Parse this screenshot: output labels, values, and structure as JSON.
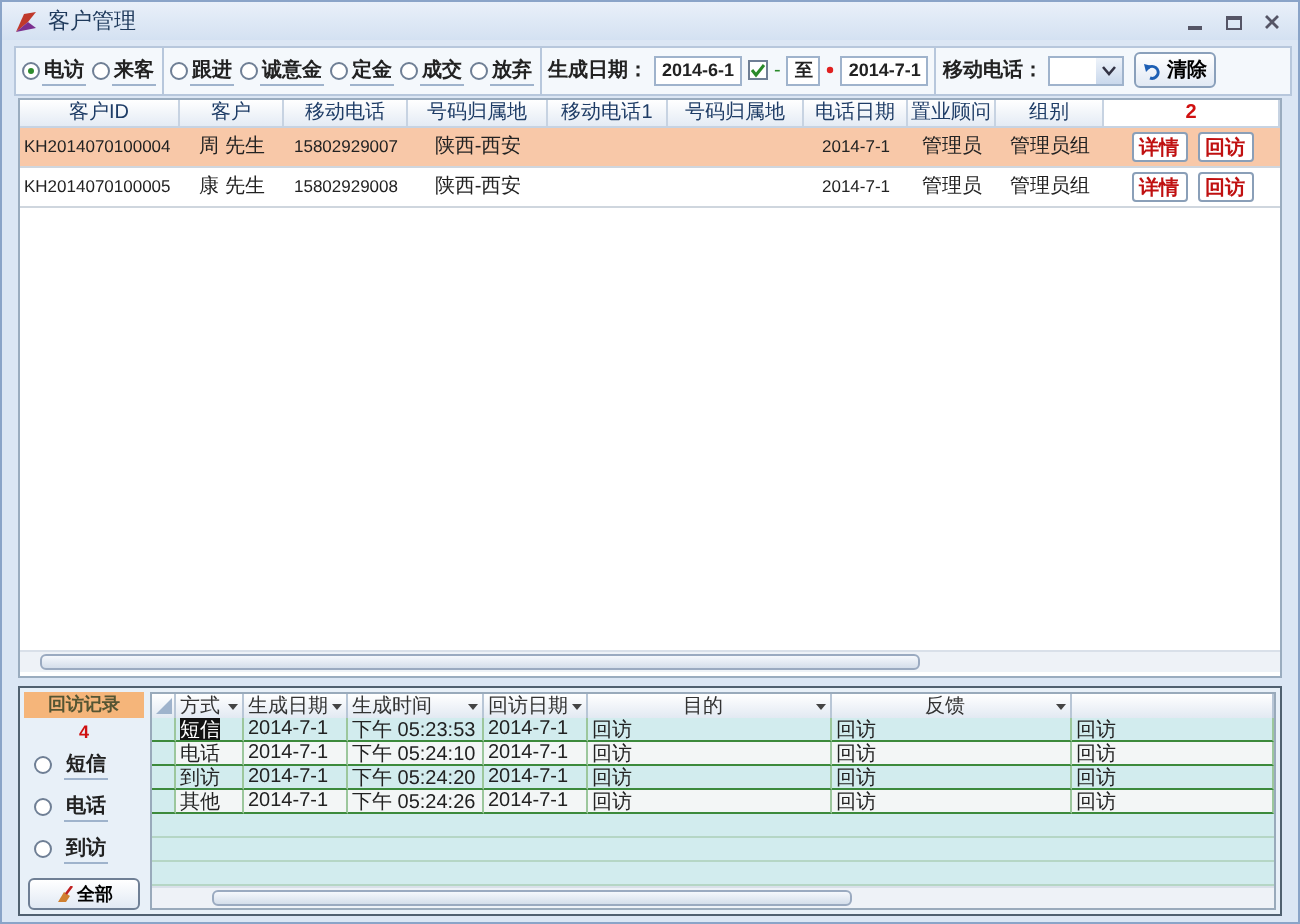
{
  "window": {
    "title": "客户管理"
  },
  "filters": {
    "status_groups": [
      [
        {
          "label": "电访",
          "selected": true
        },
        {
          "label": "来客",
          "selected": false
        }
      ],
      [
        {
          "label": "跟进",
          "selected": false
        },
        {
          "label": "诚意金",
          "selected": false
        },
        {
          "label": "定金",
          "selected": false
        },
        {
          "label": "成交",
          "selected": false
        },
        {
          "label": "放弃",
          "selected": false
        }
      ]
    ],
    "date_label": "生成日期：",
    "date_from": "2014-6-1",
    "date_range_enabled": true,
    "range_dash": "-",
    "range_to": "至",
    "date_to": "2014-7-1",
    "mobile_label": "移动电话：",
    "clear_button": "清除"
  },
  "customers": {
    "columns": [
      "客户ID",
      "客户",
      "移动电话",
      "号码归属地",
      "移动电话1",
      "号码归属地",
      "电话日期",
      "置业顾问",
      "组别"
    ],
    "row_count": "2",
    "rows": [
      {
        "selected": true,
        "cells": [
          "KH2014070100004",
          "周 先生",
          "15802929007",
          "陕西-西安",
          "",
          "",
          "2014-7-1",
          "管理员",
          "管理员组"
        ],
        "actions": [
          "详情",
          "回访"
        ]
      },
      {
        "selected": false,
        "cells": [
          "KH2014070100005",
          "康 先生",
          "15802929008",
          "陕西-西安",
          "",
          "",
          "2014-7-1",
          "管理员",
          "管理员组"
        ],
        "actions": [
          "详情",
          "回访"
        ]
      }
    ]
  },
  "followups": {
    "title": "回访记录",
    "count": "4",
    "filters": [
      {
        "label": "短信",
        "selected": false
      },
      {
        "label": "电话",
        "selected": false
      },
      {
        "label": "到访",
        "selected": false
      }
    ],
    "all_button": "全部",
    "columns": [
      {
        "label": "方式",
        "filter": true
      },
      {
        "label": "生成日期",
        "filter": true
      },
      {
        "label": "生成时间",
        "filter": true
      },
      {
        "label": "回访日期",
        "filter": true
      },
      {
        "label": "目的",
        "filter": true
      },
      {
        "label": "反馈",
        "filter": true
      },
      {
        "filter": false
      }
    ],
    "rows": [
      {
        "focused": true,
        "cells": [
          "短信",
          "2014-7-1",
          "下午 05:23:53",
          "2014-7-1",
          "回访",
          "回访",
          "回访"
        ]
      },
      {
        "focused": false,
        "cells": [
          "电话",
          "2014-7-1",
          "下午 05:24:10",
          "2014-7-1",
          "回访",
          "回访",
          "回访"
        ]
      },
      {
        "focused": false,
        "cells": [
          "到访",
          "2014-7-1",
          "下午 05:24:20",
          "2014-7-1",
          "回访",
          "回访",
          "回访"
        ]
      },
      {
        "focused": false,
        "cells": [
          "其他",
          "2014-7-1",
          "下午 05:24:26",
          "2014-7-1",
          "回访",
          "回访",
          "回访"
        ]
      }
    ]
  }
}
